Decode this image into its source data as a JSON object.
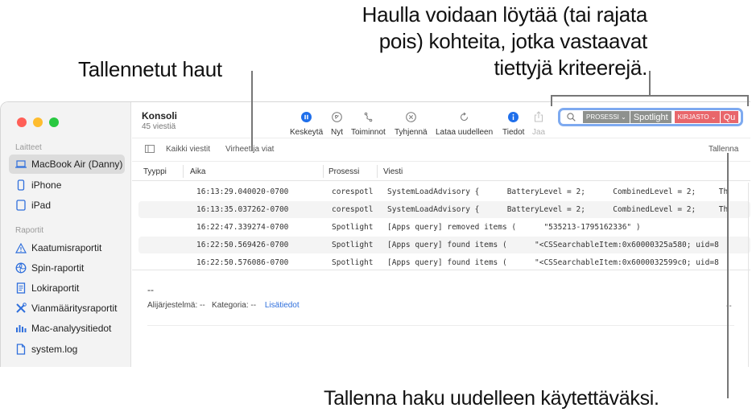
{
  "callouts": {
    "saved_searches": "Tallennetut haut",
    "search_info_lines": [
      "Haulla voidaan löytää (tai rajata",
      "pois) kohteita, jotka vastaavat",
      "tiettyjä kriteerejä."
    ],
    "save_info": "Tallenna haku uudelleen käytettäväksi."
  },
  "window": {
    "traffic_lights": {
      "close": "#ff5f57",
      "minimize": "#febc2e",
      "zoom": "#28c840"
    }
  },
  "sidebar": {
    "sections": [
      {
        "title": "Laitteet",
        "items": [
          {
            "label": "MacBook Air (Danny)",
            "icon": "laptop-icon",
            "active": true
          },
          {
            "label": "iPhone",
            "icon": "iphone-icon"
          },
          {
            "label": "iPad",
            "icon": "ipad-icon"
          }
        ]
      },
      {
        "title": "Raportit",
        "items": [
          {
            "label": "Kaatumisraportit",
            "icon": "warning-icon"
          },
          {
            "label": "Spin-raportit",
            "icon": "spin-icon"
          },
          {
            "label": "Lokiraportit",
            "icon": "document-icon"
          },
          {
            "label": "Vianmääritysraportit",
            "icon": "tools-icon"
          },
          {
            "label": "Mac-analyysitiedot",
            "icon": "chart-icon"
          },
          {
            "label": "system.log",
            "icon": "file-icon"
          }
        ]
      }
    ]
  },
  "header": {
    "title": "Konsoli",
    "subtitle": "45 viestiä"
  },
  "toolbar": {
    "pause": "Keskeytä",
    "now": "Nyt",
    "actions": "Toiminnot",
    "clear": "Tyhjennä",
    "reload": "Lataa uudelleen",
    "info": "Tiedot",
    "share": "Jaa"
  },
  "search": {
    "tokens": [
      {
        "type": "PROSESSI",
        "value": "Spotlight",
        "color": "#8e918e"
      },
      {
        "type": "KIRJASTO",
        "value": "Qu",
        "color": "#e8666b"
      }
    ]
  },
  "filterbar": {
    "all_messages": "Kaikki viestit",
    "errors_faults": "Virheet ja viat",
    "save": "Tallenna"
  },
  "table": {
    "columns": [
      "Tyyppi",
      "Aika",
      "Prosessi",
      "Viesti"
    ],
    "rows": [
      {
        "time": "16:13:29.040020-0700",
        "process": "corespotl",
        "message": "SystemLoadAdvisory {      BatteryLevel = 2;      CombinedLevel = 2;     Th"
      },
      {
        "time": "16:13:35.037262-0700",
        "process": "corespotl",
        "message": "SystemLoadAdvisory {      BatteryLevel = 2;      CombinedLevel = 2;     Th"
      },
      {
        "time": "16:22:47.339274-0700",
        "process": "Spotlight",
        "message": "[Apps query] removed items (      \"535213-1795162336\" )"
      },
      {
        "time": "16:22:50.569426-0700",
        "process": "Spotlight",
        "message": "[Apps query] found items (      \"<CSSearchableItem:0x60000325a580; uid=8"
      },
      {
        "time": "16:22:50.576086-0700",
        "process": "Spotlight",
        "message": "[Apps query] found items (      \"<CSSearchableItem:0x6000032599c0; uid=8"
      }
    ]
  },
  "detail": {
    "dash": "--",
    "subsystem": "Alijärjestelmä: --",
    "category": "Kategoria: --",
    "more_info": "Lisätiedot",
    "right_dash": "--"
  }
}
